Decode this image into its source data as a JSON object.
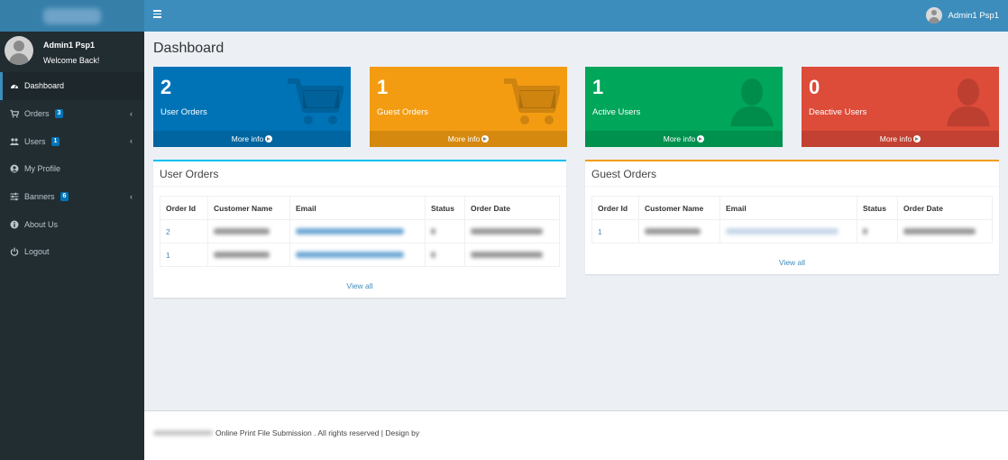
{
  "header": {
    "user_name": "Admin1 Psp1"
  },
  "sidebar": {
    "user_name": "Admin1 Psp1",
    "user_status": "Welcome Back!",
    "items": [
      {
        "label": "Dashboard",
        "icon": "dashboard-icon",
        "active": true
      },
      {
        "label": "Orders",
        "icon": "cart-icon",
        "badge": "3"
      },
      {
        "label": "Users",
        "icon": "users-icon",
        "badge": "1"
      },
      {
        "label": "My Profile",
        "icon": "user-circle-icon"
      },
      {
        "label": "Banners",
        "icon": "sliders-icon",
        "badge": "6"
      },
      {
        "label": "About Us",
        "icon": "info-icon"
      },
      {
        "label": "Logout",
        "icon": "power-icon"
      }
    ]
  },
  "page": {
    "title": "Dashboard"
  },
  "stats": [
    {
      "value": "2",
      "label": "User Orders",
      "more": "More info",
      "color": "#0073b7",
      "icon": "cart-icon"
    },
    {
      "value": "1",
      "label": "Guest Orders",
      "more": "More info",
      "color": "#f39c12",
      "icon": "cart-icon"
    },
    {
      "value": "1",
      "label": "Active Users",
      "more": "More info",
      "color": "#00a65a",
      "icon": "user-icon"
    },
    {
      "value": "0",
      "label": "Deactive Users",
      "more": "More info",
      "color": "#dd4b39",
      "icon": "user-icon"
    }
  ],
  "user_orders": {
    "title": "User Orders",
    "columns": [
      "Order Id",
      "Customer Name",
      "Email",
      "Status",
      "Order Date"
    ],
    "rows": [
      {
        "order_id": "2"
      },
      {
        "order_id": "1"
      }
    ],
    "view_all": "View all"
  },
  "guest_orders": {
    "title": "Guest Orders",
    "columns": [
      "Order Id",
      "Customer Name",
      "Email",
      "Status",
      "Order Date"
    ],
    "rows": [
      {
        "order_id": "1"
      }
    ],
    "view_all": "View all"
  },
  "footer": {
    "text": "Online Print File Submission . All rights reserved | Design by"
  }
}
